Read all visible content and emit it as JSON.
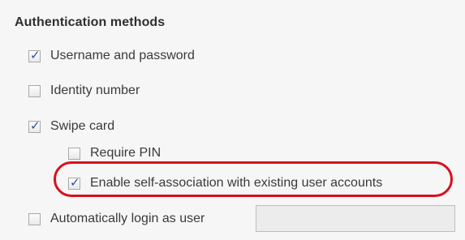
{
  "section": {
    "title": "Authentication methods"
  },
  "options": {
    "username_password": {
      "label": "Username and password",
      "checked": true
    },
    "identity_number": {
      "label": "Identity number",
      "checked": false
    },
    "swipe_card": {
      "label": "Swipe card",
      "checked": true
    },
    "require_pin": {
      "label": "Require PIN",
      "checked": false
    },
    "self_association": {
      "label": "Enable self-association with existing user accounts",
      "checked": true
    },
    "auto_login": {
      "label": "Automatically login as user",
      "checked": false,
      "value": ""
    }
  },
  "icons": {
    "checkmark": "✓"
  },
  "colors": {
    "highlight": "#d8101c",
    "check": "#2b4fa0"
  }
}
